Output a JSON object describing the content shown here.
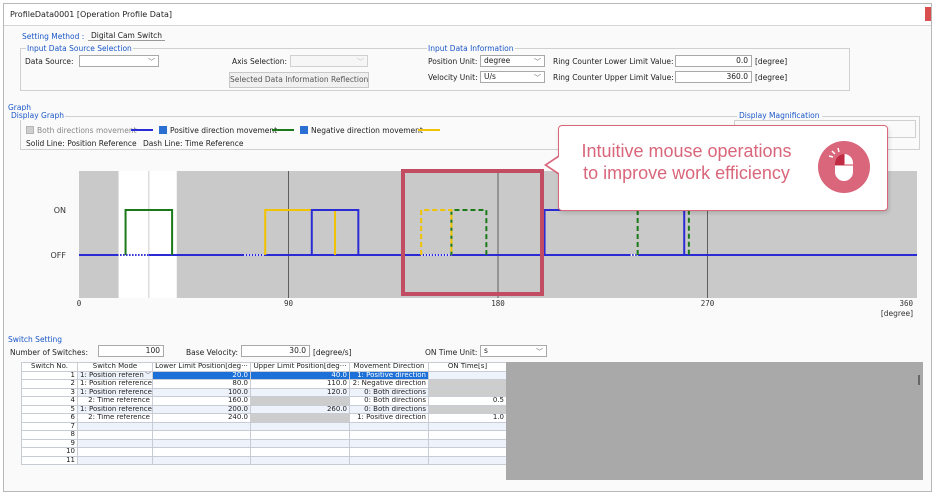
{
  "window": {
    "title": "ProfileData0001 [Operation Profile Data]"
  },
  "setting": {
    "method_label": "Setting Method :",
    "method_value": "Digital Cam Switch"
  },
  "input_source": {
    "group_label": "Input Data Source Selection",
    "data_source_label": "Data Source:",
    "data_source_value": "",
    "axis_selection_label": "Axis Selection:",
    "axis_selection_value": "",
    "reflect_button": "Selected Data Information Reflection"
  },
  "input_info": {
    "group_label": "Input Data Information",
    "position_unit_label": "Position Unit:",
    "position_unit_value": "degree",
    "velocity_unit_label": "Velocity Unit:",
    "velocity_unit_value": "U/s",
    "ring_lower_label": "Ring Counter Lower Limit Value:",
    "ring_lower_value": "0.0",
    "ring_lower_unit": "[degree]",
    "ring_upper_label": "Ring Counter Upper Limit Value:",
    "ring_upper_value": "360.0",
    "ring_upper_unit": "[degree]"
  },
  "graph": {
    "section_label": "Graph",
    "display_graph_label": "Display Graph",
    "display_magnification_label": "Display Magnification",
    "both_directions_label": "Both directions movement",
    "positive_label": "Positive direction movement",
    "negative_label": "Negative direction movement",
    "solid_line_label": "Solid Line: Position Reference",
    "dash_line_label": "Dash Line: Time Reference",
    "colors": {
      "both": "#2b2bd6",
      "positive": "#1a7a1a",
      "negative": "#f2c300"
    }
  },
  "chart_data": {
    "type": "line",
    "y_levels": [
      "ON",
      "OFF"
    ],
    "x_ticks": [
      "0",
      "90",
      "180",
      "270",
      "360"
    ],
    "x_unit": "[degree]",
    "xlim": [
      0,
      360
    ],
    "series": [
      {
        "name": "Positive direction movement",
        "color": "#1a7a1a",
        "segments": [
          {
            "x0": 20,
            "x1": 40,
            "state": "ON",
            "style": "solid"
          },
          {
            "x0": 160,
            "x1": 175,
            "state": "ON",
            "style": "dashed"
          },
          {
            "x0": 240,
            "x1": 262,
            "state": "ON",
            "style": "dashed"
          }
        ]
      },
      {
        "name": "Negative direction movement",
        "color": "#f2c300",
        "segments": [
          {
            "x0": 80,
            "x1": 110,
            "state": "ON",
            "style": "solid"
          },
          {
            "x0": 147,
            "x1": 160,
            "state": "ON",
            "style": "dashed"
          }
        ]
      },
      {
        "name": "Both directions movement",
        "color": "#2b2bd6",
        "segments": [
          {
            "x0": 100,
            "x1": 120,
            "state": "ON",
            "style": "solid"
          },
          {
            "x0": 200,
            "x1": 260,
            "state": "ON",
            "style": "solid"
          }
        ]
      }
    ]
  },
  "callout": {
    "line1": "Intuitive mouse operations",
    "line2": "to improve work efficiency"
  },
  "switch_setting": {
    "section_label": "Switch Setting",
    "num_switches_label": "Number of Switches:",
    "num_switches_value": "100",
    "base_velocity_label": "Base Velocity:",
    "base_velocity_value": "30.0",
    "base_velocity_unit": "[degree/s]",
    "on_time_unit_label": "ON Time Unit:",
    "on_time_unit_value": "s",
    "columns": [
      "Switch No.",
      "Switch Mode",
      "Lower Limit Position[deg···",
      "Upper Limit Position[deg···",
      "Movement Direction",
      "ON Time[s]"
    ],
    "rows": [
      {
        "no": "1",
        "mode": "1: Position referen",
        "lower": "20.0",
        "upper": "40.0",
        "dir": "1: Positive direction",
        "on_time": ""
      },
      {
        "no": "2",
        "mode": "1: Position reference",
        "lower": "80.0",
        "upper": "110.0",
        "dir": "2: Negative direction",
        "on_time": ""
      },
      {
        "no": "3",
        "mode": "1: Position reference",
        "lower": "100.0",
        "upper": "120.0",
        "dir": "0: Both directions",
        "on_time": ""
      },
      {
        "no": "4",
        "mode": "2: Time reference",
        "lower": "160.0",
        "upper": "",
        "dir": "0: Both directions",
        "on_time": "0.5"
      },
      {
        "no": "5",
        "mode": "1: Position reference",
        "lower": "200.0",
        "upper": "260.0",
        "dir": "0: Both directions",
        "on_time": ""
      },
      {
        "no": "6",
        "mode": "2: Time reference",
        "lower": "240.0",
        "upper": "",
        "dir": "1: Positive direction",
        "on_time": "1.0"
      },
      {
        "no": "7",
        "mode": "",
        "lower": "",
        "upper": "",
        "dir": "",
        "on_time": ""
      },
      {
        "no": "8",
        "mode": "",
        "lower": "",
        "upper": "",
        "dir": "",
        "on_time": ""
      },
      {
        "no": "9",
        "mode": "",
        "lower": "",
        "upper": "",
        "dir": "",
        "on_time": ""
      },
      {
        "no": "10",
        "mode": "",
        "lower": "",
        "upper": "",
        "dir": "",
        "on_time": ""
      },
      {
        "no": "11",
        "mode": "",
        "lower": "",
        "upper": "",
        "dir": "",
        "on_time": ""
      }
    ]
  }
}
